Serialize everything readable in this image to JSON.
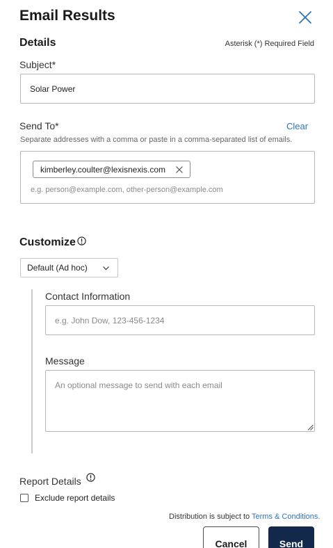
{
  "dialog": {
    "title": "Email Results",
    "close_icon": "close-icon"
  },
  "details": {
    "heading": "Details",
    "required_note": "Asterisk (*) Required Field",
    "subject_label": "Subject*",
    "subject_value": "Solar Power",
    "send_to_label": "Send To*",
    "clear_label": "Clear",
    "send_to_hint": "Separate addresses with a comma or paste in a comma-separated list of emails.",
    "recipients": [
      "kimberley.coulter@lexisnexis.com"
    ],
    "send_to_placeholder": "e.g. person@example.com, other-person@example.com"
  },
  "customize": {
    "heading": "Customize",
    "info_icon": "info-icon",
    "template_selected": "Default (Ad hoc)",
    "contact_label": "Contact Information",
    "contact_value": "",
    "contact_placeholder": "e.g. John Dow, 123-456-1234",
    "message_label": "Message",
    "message_value": "",
    "message_placeholder": "An optional message to send with each email"
  },
  "report": {
    "heading": "Report Details",
    "exclude_label": "Exclude report details",
    "exclude_checked": false
  },
  "footer": {
    "distribution_text": "Distribution is subject to",
    "terms_link": "Terms & Conditions.",
    "cancel_label": "Cancel",
    "send_label": "Send"
  },
  "colors": {
    "link": "#2f73b8",
    "primary_button": "#13294b",
    "border": "#b6b6b6"
  }
}
